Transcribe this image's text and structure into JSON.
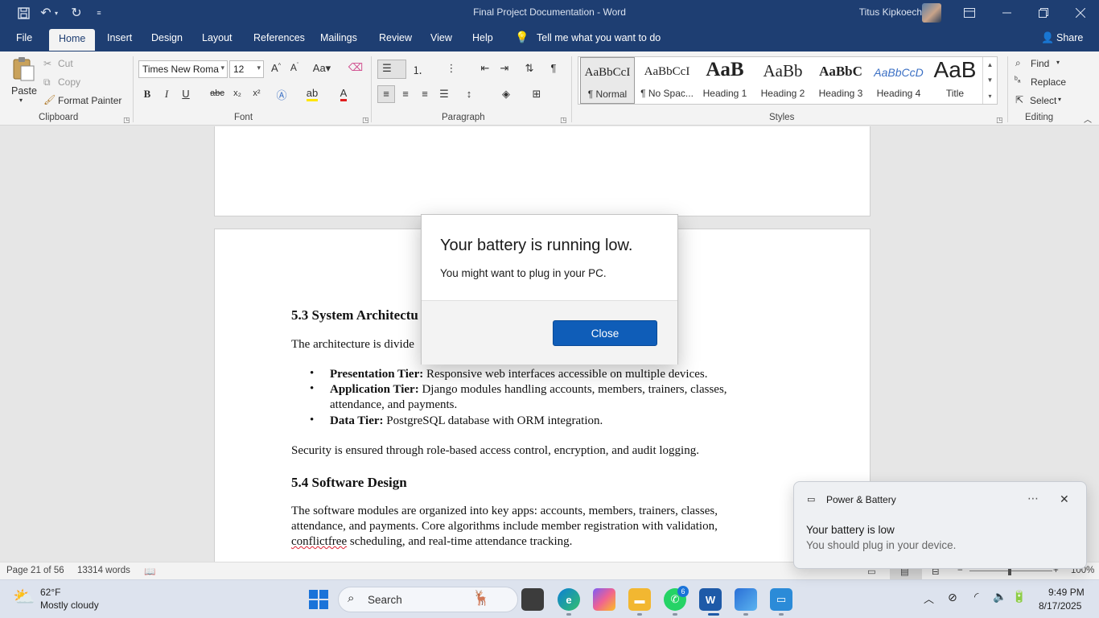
{
  "window": {
    "title": "Final Project Documentation  -  Word",
    "user_name": "Titus Kipkoech"
  },
  "menu_tabs": [
    "File",
    "Home",
    "Insert",
    "Design",
    "Layout",
    "References",
    "Mailings",
    "Review",
    "View",
    "Help"
  ],
  "tell_me": "Tell me what you want to do",
  "share_label": "Share",
  "ribbon": {
    "clipboard": {
      "label": "Clipboard",
      "paste": "Paste",
      "cut": "Cut",
      "copy": "Copy",
      "format_painter": "Format Painter"
    },
    "font": {
      "label": "Font",
      "family": "Times New Roma",
      "size": "12"
    },
    "paragraph": {
      "label": "Paragraph"
    },
    "styles": {
      "label": "Styles",
      "items": [
        {
          "preview": "AaBbCcI",
          "name": "¶ Normal"
        },
        {
          "preview": "AaBbCcI",
          "name": "¶ No Spac..."
        },
        {
          "preview": "AaB",
          "name": "Heading 1"
        },
        {
          "preview": "AaBb",
          "name": "Heading 2"
        },
        {
          "preview": "AaBbC",
          "name": "Heading 3"
        },
        {
          "preview": "AaBbCcD",
          "name": "Heading 4"
        },
        {
          "preview": "AaB",
          "name": "Title"
        }
      ]
    },
    "editing": {
      "label": "Editing",
      "find": "Find",
      "replace": "Replace",
      "select": "Select"
    }
  },
  "document": {
    "heading_53": "5.3 System Architectu",
    "para_arch": "The architecture is divide",
    "bullets": [
      {
        "term": "Presentation Tier:",
        "text": " Responsive web interfaces accessible on multiple devices."
      },
      {
        "term": "Application Tier:",
        "text": " Django modules handling accounts, members, trainers, classes, attendance, and payments."
      },
      {
        "term": "Data Tier:",
        "text": " PostgreSQL database with ORM integration."
      }
    ],
    "para_security": "Security is ensured through role-based access control, encryption, and audit logging.",
    "heading_54": "5.4 Software Design",
    "para_software_1": "The software modules are organized into key apps: accounts, members, trainers, classes, attendance, and payments. Core algorithms include member registration with validation,",
    "para_software_misspelled": "conflictfree",
    "para_software_2": " scheduling, and real-time attendance tracking."
  },
  "status_bar": {
    "page": "Page 21 of 56",
    "words": "13314 words",
    "zoom": "100%"
  },
  "dialog": {
    "title": "Your battery is running low.",
    "message": "You might want to plug in your PC.",
    "close_label": "Close"
  },
  "toast": {
    "app_name": "Power & Battery",
    "title": "Your battery is low",
    "body": "You should plug in your device."
  },
  "taskbar": {
    "weather_temp": "62°F",
    "weather_desc": "Mostly cloudy",
    "search_placeholder": "Search",
    "whatsapp_badge": "6",
    "time": "9:49 PM",
    "date": "8/17/2025"
  },
  "colors": {
    "word_blue": "#1e3e72",
    "dialog_button": "#0f5db8",
    "spell_error": "#dd2222"
  }
}
